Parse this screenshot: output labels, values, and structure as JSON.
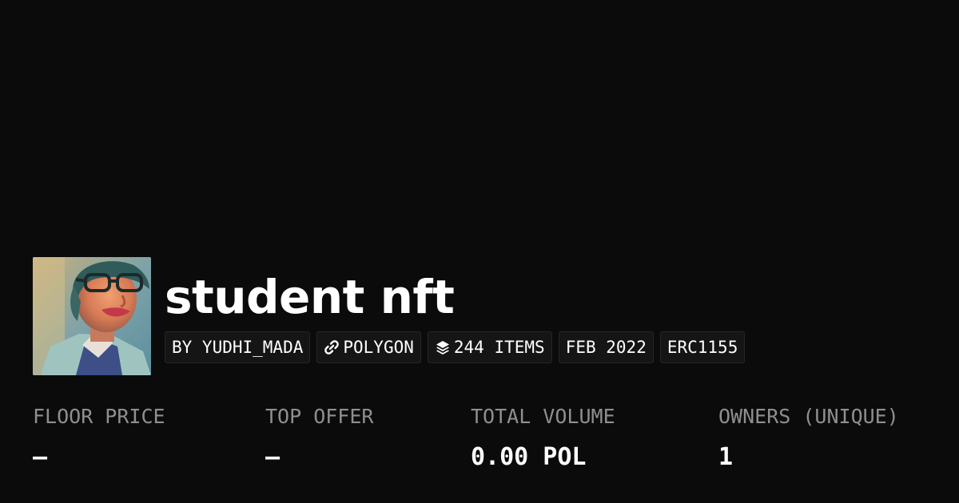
{
  "collection": {
    "name": "student nft",
    "creator": "BY YUDHI_MADA",
    "chain": "POLYGON",
    "items": "244 ITEMS",
    "created": "FEB 2022",
    "standard": "ERC1155"
  },
  "icons": {
    "chain": "link-icon",
    "items": "layers-icon"
  },
  "stats": [
    {
      "label": "FLOOR PRICE",
      "value": "–"
    },
    {
      "label": "TOP OFFER",
      "value": "–"
    },
    {
      "label": "TOTAL VOLUME",
      "value": "0.00 POL"
    },
    {
      "label": "OWNERS (UNIQUE)",
      "value": "1"
    }
  ],
  "colors": {
    "background": "#0b0b0b",
    "tag_background": "#151515",
    "label_gray": "#8f8f8f"
  }
}
